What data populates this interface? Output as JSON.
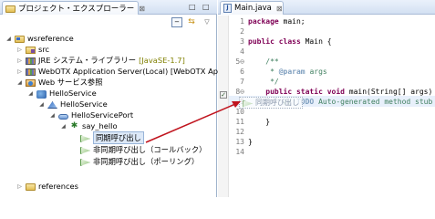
{
  "left_panel": {
    "tab_title": "プロジェクト・エクスプローラー",
    "tab_close": "⊠",
    "minimize": "□",
    "maximize": "□"
  },
  "tree": {
    "project": "wsreference",
    "src": "src",
    "jre_label": "JRE システム・ライブラリー",
    "jre_decoration": "[JavaSE-1.7]",
    "webotx": "WebOTX Application Server(Local) [WebOTX App",
    "web_service_ref": "Web サービス参照",
    "service": "HelloService",
    "binding": "HelloService",
    "port": "HelloServicePort",
    "operation": "say_hello",
    "sync_call": "同期呼び出し",
    "async_callback": "非同期呼び出し（コールバック）",
    "async_polling": "非同期呼び出し（ポーリング）",
    "references": "references"
  },
  "editor": {
    "tab_title": "Main.java",
    "tab_close": "⊠",
    "file_icon": "J",
    "line_numbers": [
      "1",
      "2",
      "3",
      "4",
      "5⊖",
      "6",
      "7",
      "8⊖",
      "9",
      "10",
      "11",
      "12",
      "13",
      "14"
    ],
    "lines": {
      "l1_kw": "package",
      "l1_rest": " main;",
      "l3_kw": "public class",
      "l3_rest": " Main {",
      "l5": "    /**",
      "l6_pre": "     * ",
      "l6_tag": "@param",
      "l6_rest": " args",
      "l7": "     */",
      "l8_kw": "    public static void",
      "l8_rest": " main(String[] args) {",
      "l9_pre": "        // ",
      "l9_todo": "TODO",
      "l9_rest": " Auto-generated method stub",
      "l11": "    }",
      "l13": "}"
    },
    "drag_label": "同期呼び出し"
  },
  "colors": {
    "arrow": "#c0141e",
    "keyword": "#7f0055",
    "comment": "#3f7f5f"
  }
}
